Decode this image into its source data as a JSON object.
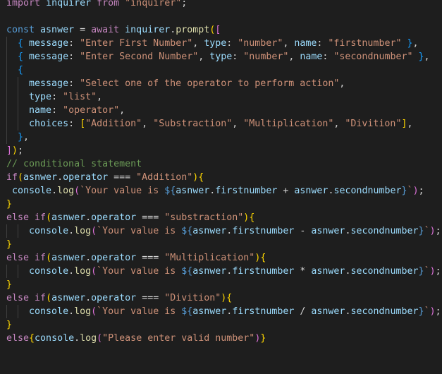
{
  "editor": {
    "language": "javascript",
    "theme": "dark",
    "background": "#1e1e1e",
    "lines": [
      [
        [
          "kw-ctrl",
          "import"
        ],
        [
          "pun",
          " "
        ],
        [
          "var",
          "inquirer"
        ],
        [
          "pun",
          " "
        ],
        [
          "kw-ctrl",
          "from"
        ],
        [
          "pun",
          " "
        ],
        [
          "str",
          "\"inquirer\""
        ],
        [
          "pun",
          ";"
        ]
      ],
      [],
      [
        [
          "kw",
          "const"
        ],
        [
          "pun",
          " "
        ],
        [
          "var",
          "asnwer"
        ],
        [
          "pun",
          " = "
        ],
        [
          "kw-ctrl",
          "await"
        ],
        [
          "pun",
          " "
        ],
        [
          "var",
          "inquirer"
        ],
        [
          "pun",
          "."
        ],
        [
          "fn",
          "prompt"
        ],
        [
          "br1",
          "("
        ],
        [
          "br2",
          "["
        ]
      ],
      [
        [
          "pun",
          "  "
        ],
        [
          "br3",
          "{"
        ],
        [
          "pun",
          " "
        ],
        [
          "var",
          "message"
        ],
        [
          "pun",
          ": "
        ],
        [
          "str",
          "\"Enter First Number\""
        ],
        [
          "pun",
          ", "
        ],
        [
          "var",
          "type"
        ],
        [
          "pun",
          ": "
        ],
        [
          "str",
          "\"number\""
        ],
        [
          "pun",
          ", "
        ],
        [
          "var",
          "name"
        ],
        [
          "pun",
          ": "
        ],
        [
          "str",
          "\"firstnumber\""
        ],
        [
          "pun",
          " "
        ],
        [
          "br3",
          "}"
        ],
        [
          "pun",
          ","
        ]
      ],
      [
        [
          "pun",
          "  "
        ],
        [
          "br3",
          "{"
        ],
        [
          "pun",
          " "
        ],
        [
          "var",
          "message"
        ],
        [
          "pun",
          ": "
        ],
        [
          "str",
          "\"Enter Second Number\""
        ],
        [
          "pun",
          ", "
        ],
        [
          "var",
          "type"
        ],
        [
          "pun",
          ": "
        ],
        [
          "str",
          "\"number\""
        ],
        [
          "pun",
          ", "
        ],
        [
          "var",
          "name"
        ],
        [
          "pun",
          ": "
        ],
        [
          "str",
          "\"secondnumber\""
        ],
        [
          "pun",
          " "
        ],
        [
          "br3",
          "}"
        ],
        [
          "pun",
          ","
        ]
      ],
      [
        [
          "pun",
          "  "
        ],
        [
          "br3",
          "{"
        ]
      ],
      [
        [
          "pun",
          "    "
        ],
        [
          "var",
          "message"
        ],
        [
          "pun",
          ": "
        ],
        [
          "str",
          "\"Select one of the operator to perform action\""
        ],
        [
          "pun",
          ","
        ]
      ],
      [
        [
          "pun",
          "    "
        ],
        [
          "var",
          "type"
        ],
        [
          "pun",
          ": "
        ],
        [
          "str",
          "\"list\""
        ],
        [
          "pun",
          ","
        ]
      ],
      [
        [
          "pun",
          "    "
        ],
        [
          "var",
          "name"
        ],
        [
          "pun",
          ": "
        ],
        [
          "str",
          "\"operator\""
        ],
        [
          "pun",
          ","
        ]
      ],
      [
        [
          "pun",
          "    "
        ],
        [
          "var",
          "choices"
        ],
        [
          "pun",
          ": "
        ],
        [
          "br1",
          "["
        ],
        [
          "str",
          "\"Addition\""
        ],
        [
          "pun",
          ", "
        ],
        [
          "str",
          "\"Substraction\""
        ],
        [
          "pun",
          ", "
        ],
        [
          "str",
          "\"Multiplication\""
        ],
        [
          "pun",
          ", "
        ],
        [
          "str",
          "\"Divition\""
        ],
        [
          "br1",
          "]"
        ],
        [
          "pun",
          ","
        ]
      ],
      [
        [
          "pun",
          "  "
        ],
        [
          "br3",
          "}"
        ],
        [
          "pun",
          ","
        ]
      ],
      [
        [
          "br2",
          "]"
        ],
        [
          "br1",
          ")"
        ],
        [
          "pun",
          ";"
        ]
      ],
      [
        [
          "cmt",
          "// conditional statement"
        ]
      ],
      [
        [
          "kw-ctrl",
          "if"
        ],
        [
          "br1",
          "("
        ],
        [
          "var",
          "asnwer"
        ],
        [
          "pun",
          "."
        ],
        [
          "var",
          "operator"
        ],
        [
          "pun",
          " === "
        ],
        [
          "str",
          "\"Addition\""
        ],
        [
          "br1",
          ")"
        ],
        [
          "br1",
          "{"
        ]
      ],
      [
        [
          "pun",
          " "
        ],
        [
          "var",
          "console"
        ],
        [
          "pun",
          "."
        ],
        [
          "fn",
          "log"
        ],
        [
          "br2",
          "("
        ],
        [
          "str",
          "`Your value is "
        ],
        [
          "tmpl-punc",
          "${"
        ],
        [
          "var",
          "asnwer"
        ],
        [
          "pun",
          "."
        ],
        [
          "var",
          "firstnumber"
        ],
        [
          "pun",
          " + "
        ],
        [
          "var",
          "asnwer"
        ],
        [
          "pun",
          "."
        ],
        [
          "var",
          "secondnumber"
        ],
        [
          "tmpl-punc",
          "}"
        ],
        [
          "str",
          "`"
        ],
        [
          "br2",
          ")"
        ],
        [
          "pun",
          ";"
        ]
      ],
      [
        [
          "br1",
          "}"
        ]
      ],
      [
        [
          "kw-ctrl",
          "else"
        ],
        [
          "pun",
          " "
        ],
        [
          "kw-ctrl",
          "if"
        ],
        [
          "br1",
          "("
        ],
        [
          "var",
          "asnwer"
        ],
        [
          "pun",
          "."
        ],
        [
          "var",
          "operator"
        ],
        [
          "pun",
          " === "
        ],
        [
          "str",
          "\"substraction\""
        ],
        [
          "br1",
          ")"
        ],
        [
          "br1",
          "{"
        ]
      ],
      [
        [
          "pun",
          "    "
        ],
        [
          "var",
          "console"
        ],
        [
          "pun",
          "."
        ],
        [
          "fn",
          "log"
        ],
        [
          "br2",
          "("
        ],
        [
          "str",
          "`Your value is "
        ],
        [
          "tmpl-punc",
          "${"
        ],
        [
          "var",
          "asnwer"
        ],
        [
          "pun",
          "."
        ],
        [
          "var",
          "firstnumber"
        ],
        [
          "pun",
          " - "
        ],
        [
          "var",
          "asnwer"
        ],
        [
          "pun",
          "."
        ],
        [
          "var",
          "secondnumber"
        ],
        [
          "tmpl-punc",
          "}"
        ],
        [
          "str",
          "`"
        ],
        [
          "br2",
          ")"
        ],
        [
          "pun",
          ";"
        ]
      ],
      [
        [
          "br1",
          "}"
        ]
      ],
      [
        [
          "kw-ctrl",
          "else"
        ],
        [
          "pun",
          " "
        ],
        [
          "kw-ctrl",
          "if"
        ],
        [
          "br1",
          "("
        ],
        [
          "var",
          "asnwer"
        ],
        [
          "pun",
          "."
        ],
        [
          "var",
          "operator"
        ],
        [
          "pun",
          " === "
        ],
        [
          "str",
          "\"Multiplication\""
        ],
        [
          "br1",
          ")"
        ],
        [
          "br1",
          "{"
        ]
      ],
      [
        [
          "pun",
          "    "
        ],
        [
          "var",
          "console"
        ],
        [
          "pun",
          "."
        ],
        [
          "fn",
          "log"
        ],
        [
          "br2",
          "("
        ],
        [
          "str",
          "`Your value is "
        ],
        [
          "tmpl-punc",
          "${"
        ],
        [
          "var",
          "asnwer"
        ],
        [
          "pun",
          "."
        ],
        [
          "var",
          "firstnumber"
        ],
        [
          "pun",
          " * "
        ],
        [
          "var",
          "asnwer"
        ],
        [
          "pun",
          "."
        ],
        [
          "var",
          "secondnumber"
        ],
        [
          "tmpl-punc",
          "}"
        ],
        [
          "str",
          "`"
        ],
        [
          "br2",
          ")"
        ],
        [
          "pun",
          ";"
        ]
      ],
      [
        [
          "br1",
          "}"
        ]
      ],
      [
        [
          "kw-ctrl",
          "else"
        ],
        [
          "pun",
          " "
        ],
        [
          "kw-ctrl",
          "if"
        ],
        [
          "br1",
          "("
        ],
        [
          "var",
          "asnwer"
        ],
        [
          "pun",
          "."
        ],
        [
          "var",
          "operator"
        ],
        [
          "pun",
          " === "
        ],
        [
          "str",
          "\"Divition\""
        ],
        [
          "br1",
          ")"
        ],
        [
          "br1",
          "{"
        ]
      ],
      [
        [
          "pun",
          "    "
        ],
        [
          "var",
          "console"
        ],
        [
          "pun",
          "."
        ],
        [
          "fn",
          "log"
        ],
        [
          "br2",
          "("
        ],
        [
          "str",
          "`Your value is "
        ],
        [
          "tmpl-punc",
          "${"
        ],
        [
          "var",
          "asnwer"
        ],
        [
          "pun",
          "."
        ],
        [
          "var",
          "firstnumber"
        ],
        [
          "pun",
          " / "
        ],
        [
          "var",
          "asnwer"
        ],
        [
          "pun",
          "."
        ],
        [
          "var",
          "secondnumber"
        ],
        [
          "tmpl-punc",
          "}"
        ],
        [
          "str",
          "`"
        ],
        [
          "br2",
          ")"
        ],
        [
          "pun",
          ";"
        ]
      ],
      [
        [
          "br1",
          "}"
        ]
      ],
      [
        [
          "kw-ctrl",
          "else"
        ],
        [
          "br1",
          "{"
        ],
        [
          "var",
          "console"
        ],
        [
          "pun",
          "."
        ],
        [
          "fn",
          "log"
        ],
        [
          "br2",
          "("
        ],
        [
          "str",
          "\"Please enter valid number\""
        ],
        [
          "br2",
          ")"
        ],
        [
          "br1",
          "}"
        ]
      ]
    ]
  }
}
